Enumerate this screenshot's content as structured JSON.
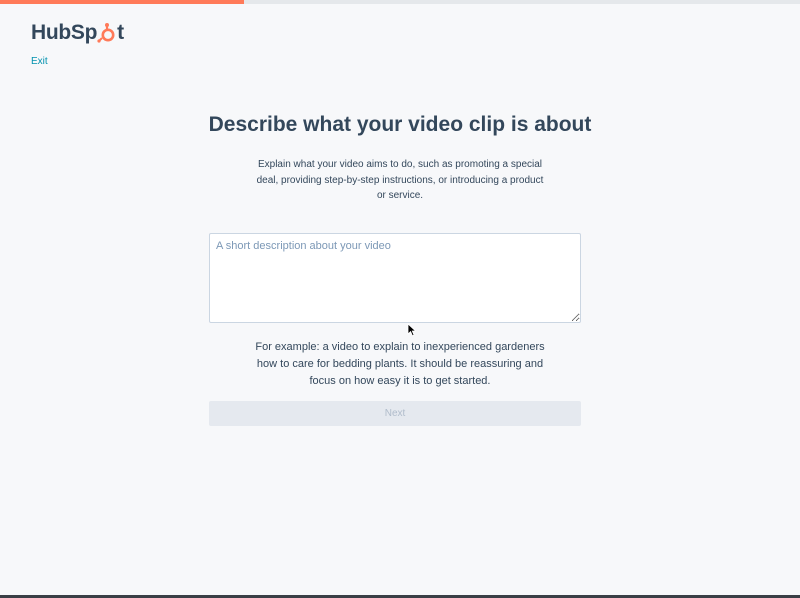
{
  "progress": {
    "fraction": 0.305,
    "fill_color": "#ff7a59"
  },
  "brand": {
    "name_part1": "HubSp",
    "name_part2": "t",
    "icon": "sprocket-icon",
    "accent": "#ff7a59"
  },
  "header": {
    "exit_label": "Exit"
  },
  "main": {
    "title": "Describe what your video clip is about",
    "intro": "Explain what your video aims to do, such as promoting a special deal, providing step-by-step instructions, or introducing a product or service.",
    "description_placeholder": "A short description about your video",
    "description_value": "",
    "example": "For example: a video to explain to inexperienced gardeners how to care for bedding plants. It should be reassuring and focus on how easy it is to get started.",
    "next_label": "Next",
    "next_disabled": true
  }
}
